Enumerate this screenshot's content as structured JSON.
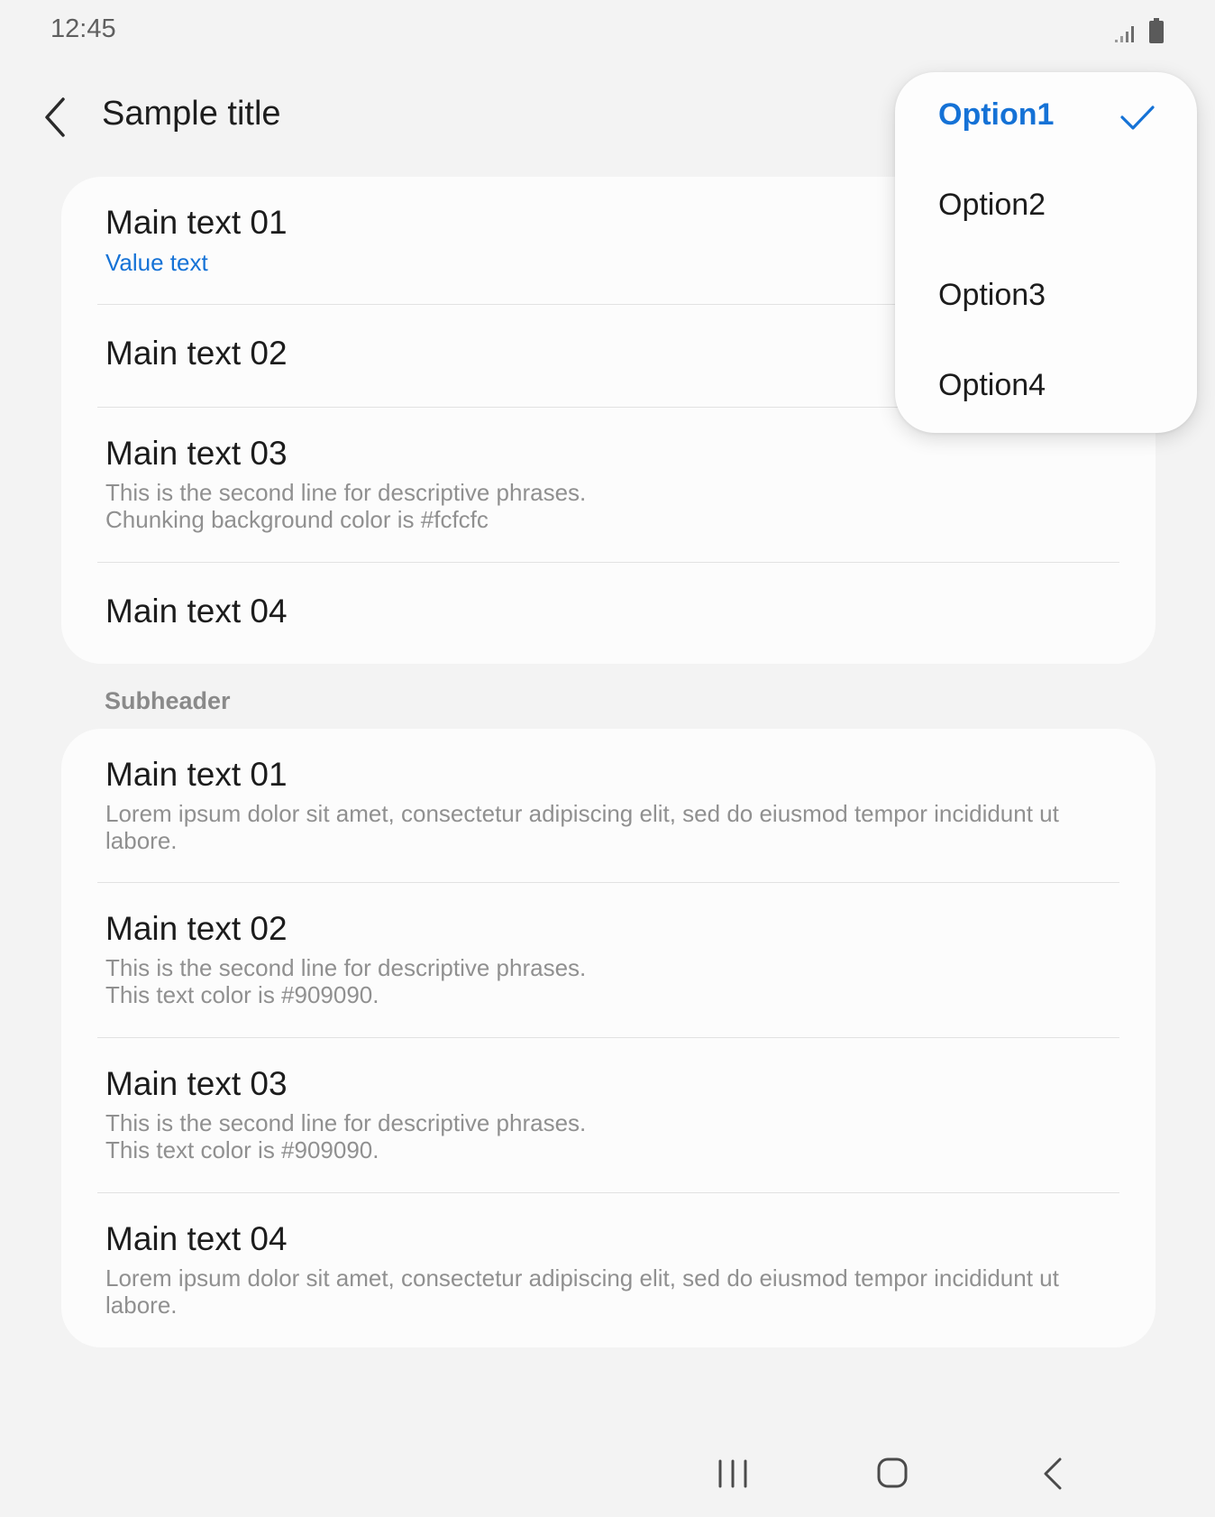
{
  "status_bar": {
    "time": "12:45",
    "icons": [
      "signal-icon",
      "battery-icon"
    ]
  },
  "app_bar": {
    "title": "Sample title",
    "back_icon": "chevron-left-icon"
  },
  "card1": {
    "rows": [
      {
        "main": "Main text 01",
        "value": "Value text"
      },
      {
        "main": "Main text 02"
      },
      {
        "main": "Main text 03",
        "sub1": "This is the second line for descriptive phrases.",
        "sub2": "Chunking background color is #fcfcfc"
      },
      {
        "main": "Main text 04"
      }
    ]
  },
  "subheader": "Subheader",
  "card2": {
    "rows": [
      {
        "main": "Main text 01",
        "sub": "Lorem ipsum dolor sit amet, consectetur adipiscing elit, sed do eiusmod tempor incididunt ut labore."
      },
      {
        "main": "Main text 02",
        "sub1": "This is the second line for descriptive phrases.",
        "sub2": "This text color is #909090."
      },
      {
        "main": "Main text 03",
        "sub1": "This is the second line for descriptive phrases.",
        "sub2": "This text color is #909090."
      },
      {
        "main": "Main text 04",
        "sub": "Lorem ipsum dolor sit amet, consectetur adipiscing elit, sed do eiusmod tempor incididunt ut labore."
      }
    ]
  },
  "dropdown": {
    "options": [
      {
        "label": "Option1",
        "selected": true
      },
      {
        "label": "Option2",
        "selected": false
      },
      {
        "label": "Option3",
        "selected": false
      },
      {
        "label": "Option4",
        "selected": false
      }
    ]
  },
  "nav_bar": {
    "icons": [
      "recents-icon",
      "home-icon",
      "back-icon"
    ]
  },
  "colors": {
    "accent": "#1572d6",
    "card_bg": "#fcfcfc",
    "secondary_text": "#909090",
    "page_bg": "#f3f3f3"
  }
}
